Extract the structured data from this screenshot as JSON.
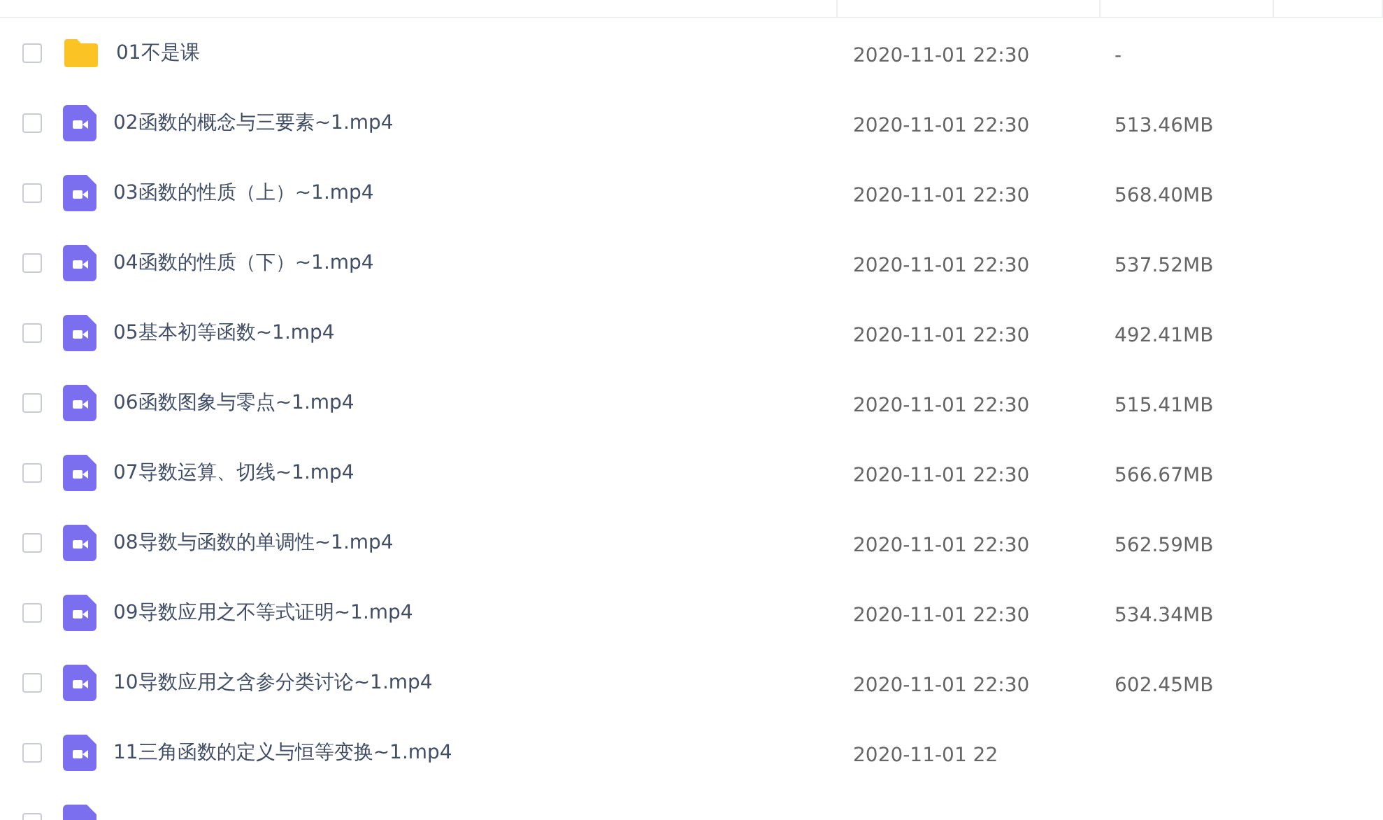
{
  "files": [
    {
      "kind": "folder",
      "name": "01不是课",
      "date": "2020-11-01 22:30",
      "size": "-",
      "checked": false
    },
    {
      "kind": "video",
      "name": "02函数的概念与三要素~1.mp4",
      "date": "2020-11-01 22:30",
      "size": "513.46MB",
      "checked": false
    },
    {
      "kind": "video",
      "name": "03函数的性质（上）~1.mp4",
      "date": "2020-11-01 22:30",
      "size": "568.40MB",
      "checked": false
    },
    {
      "kind": "video",
      "name": "04函数的性质（下）~1.mp4",
      "date": "2020-11-01 22:30",
      "size": "537.52MB",
      "checked": false
    },
    {
      "kind": "video",
      "name": "05基本初等函数~1.mp4",
      "date": "2020-11-01 22:30",
      "size": "492.41MB",
      "checked": false
    },
    {
      "kind": "video",
      "name": "06函数图象与零点~1.mp4",
      "date": "2020-11-01 22:30",
      "size": "515.41MB",
      "checked": false
    },
    {
      "kind": "video",
      "name": "07导数运算、切线~1.mp4",
      "date": "2020-11-01 22:30",
      "size": "566.67MB",
      "checked": false
    },
    {
      "kind": "video",
      "name": "08导数与函数的单调性~1.mp4",
      "date": "2020-11-01 22:30",
      "size": "562.59MB",
      "checked": false
    },
    {
      "kind": "video",
      "name": "09导数应用之不等式证明~1.mp4",
      "date": "2020-11-01 22:30",
      "size": "534.34MB",
      "checked": false
    },
    {
      "kind": "video",
      "name": "10导数应用之含参分类讨论~1.mp4",
      "date": "2020-11-01 22:30",
      "size": "602.45MB",
      "checked": false
    },
    {
      "kind": "video",
      "name": "11三角函数的定义与恒等变换~1.mp4",
      "date": "2020-11-01 22",
      "checked": false
    },
    {
      "kind": "video",
      "checked": false
    }
  ]
}
